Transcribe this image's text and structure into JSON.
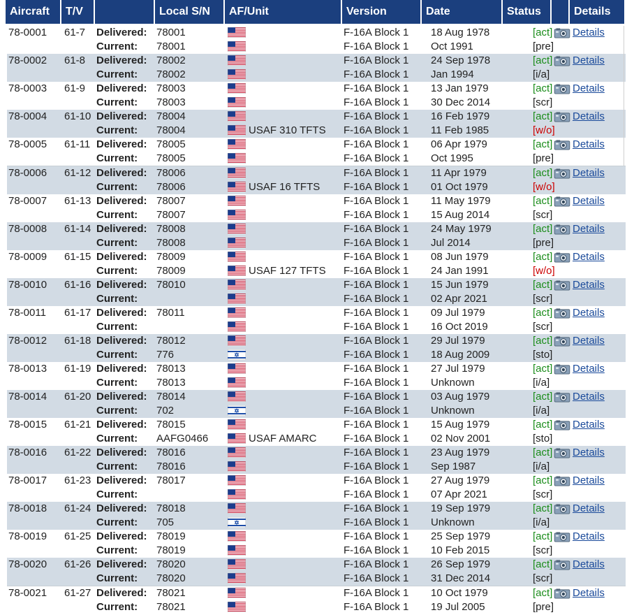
{
  "headers": [
    "Aircraft",
    "T/V",
    "",
    "Local S/N",
    "AF/Unit",
    "Version",
    "Date",
    "Status",
    "",
    "Details"
  ],
  "labels": {
    "delivered": "Delivered:",
    "current": "Current:",
    "details": "Details"
  },
  "colors": {
    "header_bg": "#1b3f7e",
    "row_alt": "#d2dbe4",
    "status_act": "#1a8c1a",
    "status_wo": "#cc0000",
    "link": "#1a4a9a"
  },
  "records": [
    {
      "aircraft": "78-0001",
      "tv": "61-7",
      "del_sn": "78001",
      "del_flag": "us",
      "del_unit": "",
      "del_version": "F-16A Block 1",
      "del_date": "18 Aug 1978",
      "cur_sn": "78001",
      "cur_flag": "us",
      "cur_unit": "",
      "cur_version": "F-16A Block 1",
      "cur_date": "Oct 1991",
      "status": "[pre]"
    },
    {
      "aircraft": "78-0002",
      "tv": "61-8",
      "del_sn": "78002",
      "del_flag": "us",
      "del_unit": "",
      "del_version": "F-16A Block 1",
      "del_date": "24 Sep 1978",
      "cur_sn": "78002",
      "cur_flag": "us",
      "cur_unit": "",
      "cur_version": "F-16A Block 1",
      "cur_date": "Jan 1994",
      "status": "[i/a]"
    },
    {
      "aircraft": "78-0003",
      "tv": "61-9",
      "del_sn": "78003",
      "del_flag": "us",
      "del_unit": "",
      "del_version": "F-16A Block 1",
      "del_date": "13 Jan 1979",
      "cur_sn": "78003",
      "cur_flag": "us",
      "cur_unit": "",
      "cur_version": "F-16A Block 1",
      "cur_date": "30 Dec 2014",
      "status": "[scr]"
    },
    {
      "aircraft": "78-0004",
      "tv": "61-10",
      "del_sn": "78004",
      "del_flag": "us",
      "del_unit": "",
      "del_version": "F-16A Block 1",
      "del_date": "16 Feb 1979",
      "cur_sn": "78004",
      "cur_flag": "us",
      "cur_unit": "USAF 310 TFTS",
      "cur_version": "F-16A Block 1",
      "cur_date": "11 Feb 1985",
      "status": "[w/o]"
    },
    {
      "aircraft": "78-0005",
      "tv": "61-11",
      "del_sn": "78005",
      "del_flag": "us",
      "del_unit": "",
      "del_version": "F-16A Block 1",
      "del_date": "06 Apr 1979",
      "cur_sn": "78005",
      "cur_flag": "us",
      "cur_unit": "",
      "cur_version": "F-16A Block 1",
      "cur_date": "Oct 1995",
      "status": "[pre]"
    },
    {
      "aircraft": "78-0006",
      "tv": "61-12",
      "del_sn": "78006",
      "del_flag": "us",
      "del_unit": "",
      "del_version": "F-16A Block 1",
      "del_date": "11 Apr 1979",
      "cur_sn": "78006",
      "cur_flag": "us",
      "cur_unit": "USAF 16 TFTS",
      "cur_version": "F-16A Block 1",
      "cur_date": "01 Oct 1979",
      "status": "[w/o]"
    },
    {
      "aircraft": "78-0007",
      "tv": "61-13",
      "del_sn": "78007",
      "del_flag": "us",
      "del_unit": "",
      "del_version": "F-16A Block 1",
      "del_date": "11 May 1979",
      "cur_sn": "78007",
      "cur_flag": "us",
      "cur_unit": "",
      "cur_version": "F-16A Block 1",
      "cur_date": "15 Aug 2014",
      "status": "[scr]"
    },
    {
      "aircraft": "78-0008",
      "tv": "61-14",
      "del_sn": "78008",
      "del_flag": "us",
      "del_unit": "",
      "del_version": "F-16A Block 1",
      "del_date": "24 May 1979",
      "cur_sn": "78008",
      "cur_flag": "us",
      "cur_unit": "",
      "cur_version": "F-16A Block 1",
      "cur_date": "Jul 2014",
      "status": "[pre]"
    },
    {
      "aircraft": "78-0009",
      "tv": "61-15",
      "del_sn": "78009",
      "del_flag": "us",
      "del_unit": "",
      "del_version": "F-16A Block 1",
      "del_date": "08 Jun 1979",
      "cur_sn": "78009",
      "cur_flag": "us",
      "cur_unit": "USAF 127 TFTS",
      "cur_version": "F-16A Block 1",
      "cur_date": "24 Jan 1991",
      "status": "[w/o]"
    },
    {
      "aircraft": "78-0010",
      "tv": "61-16",
      "del_sn": "78010",
      "del_flag": "us",
      "del_unit": "",
      "del_version": "F-16A Block 1",
      "del_date": "15 Jun 1979",
      "cur_sn": "",
      "cur_flag": "us",
      "cur_unit": "",
      "cur_version": "F-16A Block 1",
      "cur_date": "02 Apr 2021",
      "status": "[scr]"
    },
    {
      "aircraft": "78-0011",
      "tv": "61-17",
      "del_sn": "78011",
      "del_flag": "us",
      "del_unit": "",
      "del_version": "F-16A Block 1",
      "del_date": "09 Jul 1979",
      "cur_sn": "",
      "cur_flag": "us",
      "cur_unit": "",
      "cur_version": "F-16A Block 1",
      "cur_date": "16 Oct 2019",
      "status": "[scr]"
    },
    {
      "aircraft": "78-0012",
      "tv": "61-18",
      "del_sn": "78012",
      "del_flag": "us",
      "del_unit": "",
      "del_version": "F-16A Block 1",
      "del_date": "29 Jul 1979",
      "cur_sn": "776",
      "cur_flag": "il",
      "cur_unit": "",
      "cur_version": "F-16A Block 1",
      "cur_date": "18 Aug 2009",
      "status": "[sto]"
    },
    {
      "aircraft": "78-0013",
      "tv": "61-19",
      "del_sn": "78013",
      "del_flag": "us",
      "del_unit": "",
      "del_version": "F-16A Block 1",
      "del_date": "27 Jul 1979",
      "cur_sn": "78013",
      "cur_flag": "us",
      "cur_unit": "",
      "cur_version": "F-16A Block 1",
      "cur_date": "Unknown",
      "status": "[i/a]"
    },
    {
      "aircraft": "78-0014",
      "tv": "61-20",
      "del_sn": "78014",
      "del_flag": "us",
      "del_unit": "",
      "del_version": "F-16A Block 1",
      "del_date": "03 Aug 1979",
      "cur_sn": "702",
      "cur_flag": "il",
      "cur_unit": "",
      "cur_version": "F-16A Block 1",
      "cur_date": "Unknown",
      "status": "[i/a]"
    },
    {
      "aircraft": "78-0015",
      "tv": "61-21",
      "del_sn": "78015",
      "del_flag": "us",
      "del_unit": "",
      "del_version": "F-16A Block 1",
      "del_date": "15 Aug 1979",
      "cur_sn": "AAFG0466",
      "cur_flag": "us",
      "cur_unit": "USAF AMARC",
      "cur_version": "F-16A Block 1",
      "cur_date": "02 Nov 2001",
      "status": "[sto]"
    },
    {
      "aircraft": "78-0016",
      "tv": "61-22",
      "del_sn": "78016",
      "del_flag": "us",
      "del_unit": "",
      "del_version": "F-16A Block 1",
      "del_date": "23 Aug 1979",
      "cur_sn": "78016",
      "cur_flag": "us",
      "cur_unit": "",
      "cur_version": "F-16A Block 1",
      "cur_date": "Sep 1987",
      "status": "[i/a]"
    },
    {
      "aircraft": "78-0017",
      "tv": "61-23",
      "del_sn": "78017",
      "del_flag": "us",
      "del_unit": "",
      "del_version": "F-16A Block 1",
      "del_date": "27 Aug 1979",
      "cur_sn": "",
      "cur_flag": "us",
      "cur_unit": "",
      "cur_version": "F-16A Block 1",
      "cur_date": "07 Apr 2021",
      "status": "[scr]"
    },
    {
      "aircraft": "78-0018",
      "tv": "61-24",
      "del_sn": "78018",
      "del_flag": "us",
      "del_unit": "",
      "del_version": "F-16A Block 1",
      "del_date": "19 Sep 1979",
      "cur_sn": "705",
      "cur_flag": "il",
      "cur_unit": "",
      "cur_version": "F-16A Block 1",
      "cur_date": "Unknown",
      "status": "[i/a]"
    },
    {
      "aircraft": "78-0019",
      "tv": "61-25",
      "del_sn": "78019",
      "del_flag": "us",
      "del_unit": "",
      "del_version": "F-16A Block 1",
      "del_date": "25 Sep 1979",
      "cur_sn": "78019",
      "cur_flag": "us",
      "cur_unit": "",
      "cur_version": "F-16A Block 1",
      "cur_date": "10 Feb 2015",
      "status": "[scr]"
    },
    {
      "aircraft": "78-0020",
      "tv": "61-26",
      "del_sn": "78020",
      "del_flag": "us",
      "del_unit": "",
      "del_version": "F-16A Block 1",
      "del_date": "26 Sep 1979",
      "cur_sn": "78020",
      "cur_flag": "us",
      "cur_unit": "",
      "cur_version": "F-16A Block 1",
      "cur_date": "31 Dec 2014",
      "status": "[scr]"
    },
    {
      "aircraft": "78-0021",
      "tv": "61-27",
      "del_sn": "78021",
      "del_flag": "us",
      "del_unit": "",
      "del_version": "F-16A Block 1",
      "del_date": "10 Oct 1979",
      "cur_sn": "78021",
      "cur_flag": "us",
      "cur_unit": "",
      "cur_version": "F-16A Block 1",
      "cur_date": "19 Jul 2005",
      "status": "[pre]"
    }
  ],
  "delivered_status": "[act]"
}
